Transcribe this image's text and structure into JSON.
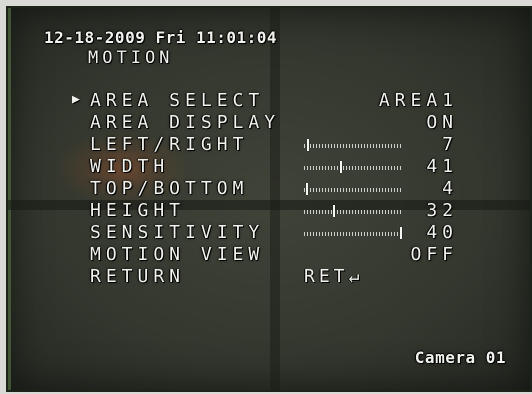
{
  "osd": {
    "timestamp": "12-18-2009 Fri 11:01:04",
    "camera_label": "Camera 01"
  },
  "menu": {
    "title": "MOTION",
    "cursor": "▶",
    "items": [
      {
        "label": "AREA SELECT",
        "value": "AREA1"
      },
      {
        "label": "AREA DISPLAY",
        "value": "ON"
      },
      {
        "label": "LEFT/RIGHT",
        "value": "7",
        "slider": 0.03
      },
      {
        "label": "WIDTH",
        "value": "41",
        "slider": 0.38
      },
      {
        "label": "TOP/BOTTOM",
        "value": "4",
        "slider": 0.02
      },
      {
        "label": "HEIGHT",
        "value": "32",
        "slider": 0.3
      },
      {
        "label": "SENSITIVITY",
        "value": "40",
        "slider": 1.0
      },
      {
        "label": "MOTION VIEW",
        "value": "OFF"
      },
      {
        "label": "RETURN",
        "value": "RET↵"
      }
    ]
  },
  "colors": {
    "osd_text": "#f2f2ee",
    "screen_bg": "#33372e"
  }
}
